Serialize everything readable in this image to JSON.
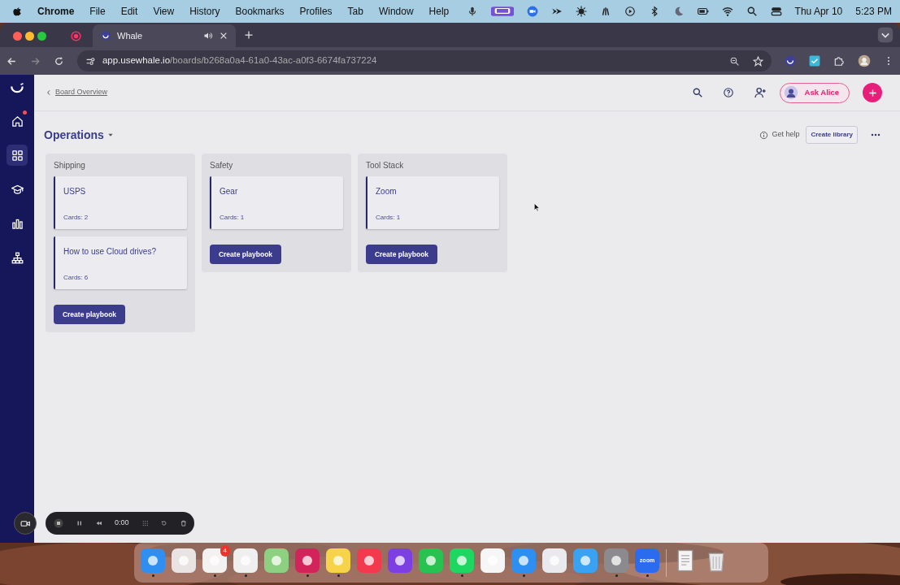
{
  "menu_bar": {
    "app": "Chrome",
    "menus": [
      "File",
      "Edit",
      "View",
      "History",
      "Bookmarks",
      "Profiles",
      "Tab",
      "Window",
      "Help"
    ],
    "date": "Thu Apr 10",
    "time": "5:23 PM"
  },
  "browser": {
    "tabs": [
      {
        "title": "Whale",
        "selected": true
      }
    ],
    "url_host": "app.usewhale.io",
    "url_path": "/boards/b268a0a4-61a0-43ac-a0f3-6674fa737224"
  },
  "sidebar": {
    "items": [
      {
        "kind": "home",
        "selected": false,
        "notification": true
      },
      {
        "kind": "boards",
        "selected": true,
        "notification": false
      },
      {
        "kind": "learn",
        "selected": false,
        "notification": false
      },
      {
        "kind": "analytics",
        "selected": false,
        "notification": false
      },
      {
        "kind": "org",
        "selected": false,
        "notification": false
      }
    ]
  },
  "header": {
    "breadcrumb": "Board Overview",
    "assistant_button": "Ask Alice"
  },
  "board": {
    "title": "Operations",
    "help": "Get help",
    "create_library": "Create library",
    "columns": [
      {
        "title": "Shipping",
        "playbooks": [
          {
            "title": "USPS",
            "cards": "Cards: 2"
          },
          {
            "title": "How to use Cloud drives?",
            "cards": "Cards: 6"
          }
        ],
        "button": "Create playbook"
      },
      {
        "title": "Safety",
        "playbooks": [
          {
            "title": "Gear",
            "cards": "Cards: 1"
          }
        ],
        "button": "Create playbook"
      },
      {
        "title": "Tool Stack",
        "playbooks": [
          {
            "title": "Zoom",
            "cards": "Cards: 1"
          }
        ],
        "button": "Create playbook"
      }
    ]
  },
  "recorder": {
    "time": "0:00"
  },
  "dock": {
    "items": [
      {
        "kind": "app",
        "color": "#2f8ff0",
        "running": true
      },
      {
        "kind": "app",
        "color": "#e9e3e3",
        "running": false
      },
      {
        "kind": "app",
        "color": "#f4f1f1",
        "running": true,
        "badge": "4"
      },
      {
        "kind": "app",
        "color": "#f0efef",
        "running": true
      },
      {
        "kind": "app",
        "color": "#8ed081",
        "running": false
      },
      {
        "kind": "app",
        "color": "#d2245a",
        "running": true
      },
      {
        "kind": "app",
        "color": "#f7d34a",
        "running": true
      },
      {
        "kind": "app",
        "color": "#f2394e",
        "running": false
      },
      {
        "kind": "app",
        "color": "#7b3fe4",
        "running": false
      },
      {
        "kind": "app",
        "color": "#28c251",
        "running": false
      },
      {
        "kind": "app",
        "color": "#1ed760",
        "running": true
      },
      {
        "kind": "app",
        "color": "#f6f6f6",
        "running": false
      },
      {
        "kind": "app",
        "color": "#2e8ff3",
        "running": true
      },
      {
        "kind": "app",
        "color": "#e9e9ee",
        "running": false
      },
      {
        "kind": "app",
        "color": "#3aa2f2",
        "running": false
      },
      {
        "kind": "app",
        "color": "#8a8a8f",
        "running": true
      },
      {
        "kind": "app",
        "color": "#2b6bf0",
        "running": true,
        "label": "zoom"
      },
      {
        "kind": "document",
        "running": false
      },
      {
        "kind": "trash",
        "running": false
      }
    ]
  }
}
